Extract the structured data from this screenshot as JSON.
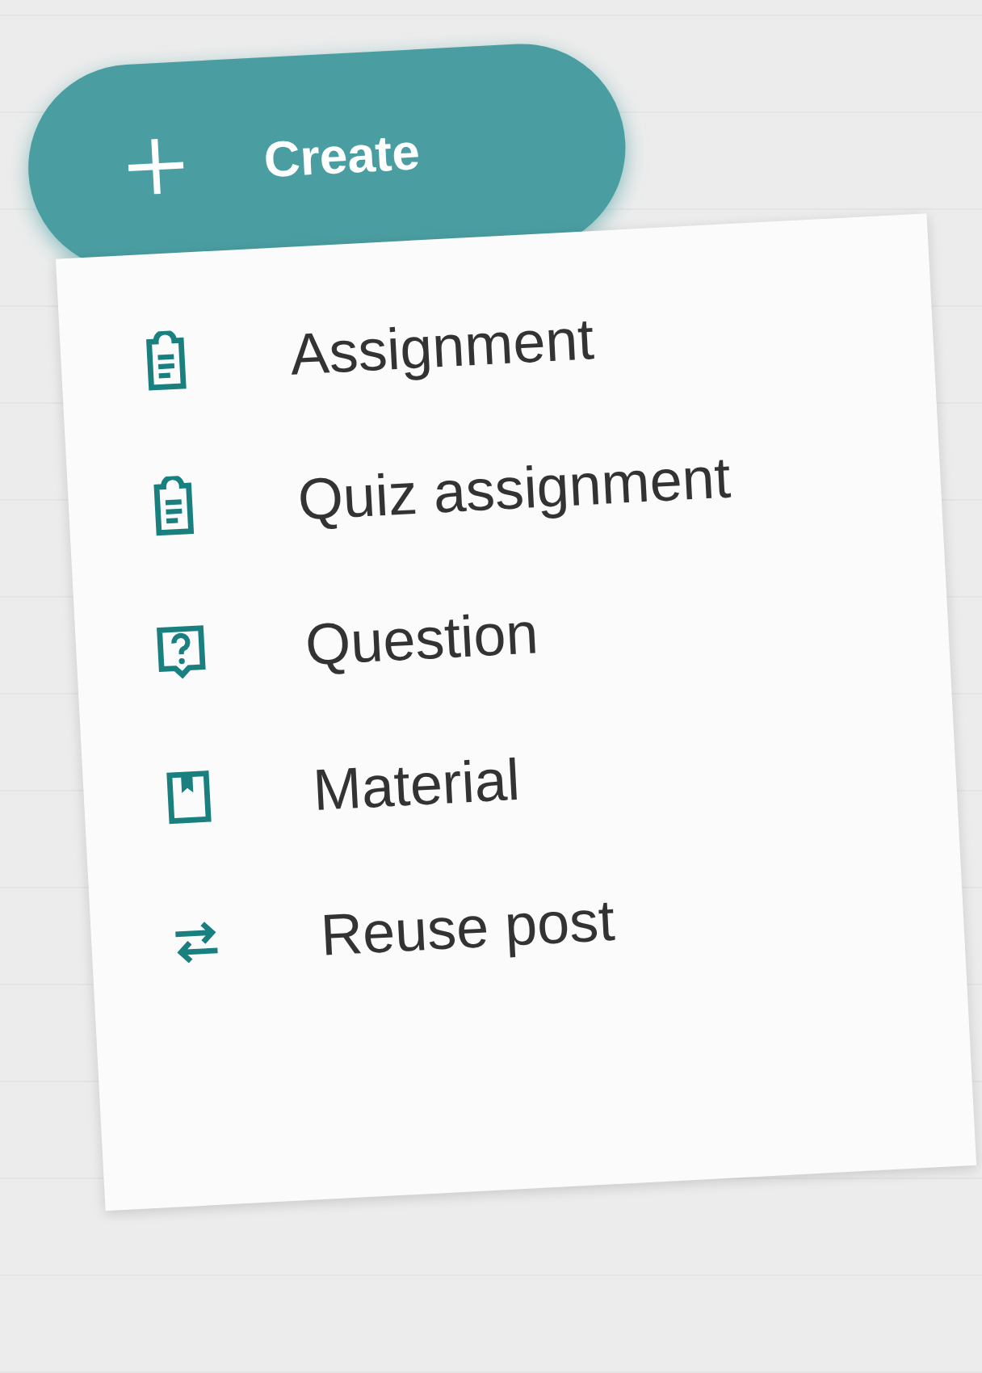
{
  "create_button": {
    "label": "Create"
  },
  "menu": {
    "items": [
      {
        "kind": "assignment",
        "label": "Assignment"
      },
      {
        "kind": "quiz",
        "label": "Quiz assignment"
      },
      {
        "kind": "question",
        "label": "Question"
      },
      {
        "kind": "material",
        "label": "Material"
      },
      {
        "kind": "reuse",
        "label": "Reuse post"
      }
    ]
  }
}
